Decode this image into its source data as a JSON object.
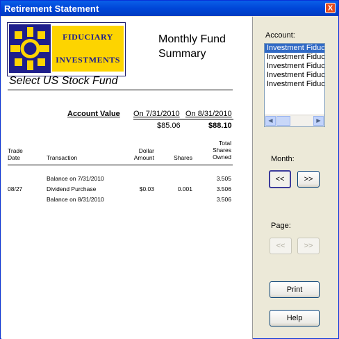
{
  "window": {
    "title": "Retirement Statement",
    "close_glyph": "X"
  },
  "logo": {
    "line1": "FIDUCIARY",
    "line2": "INVESTMENTS"
  },
  "report": {
    "title_line1": "Monthly Fund",
    "title_line2": "Summary",
    "fund_name": "Select US Stock Fund"
  },
  "account_value": {
    "label": "Account Value",
    "date1_label": "On 7/31/2010",
    "date2_label": "On 8/31/2010",
    "value1": "$85.06",
    "value2": "$88.10"
  },
  "table": {
    "headers": {
      "trade_date_1": "Trade",
      "trade_date_2": "Date",
      "transaction": "Transaction",
      "dollar_1": "Dollar",
      "dollar_2": "Amount",
      "shares": "Shares",
      "total_1": "Total",
      "total_2": "Shares",
      "total_3": "Owned"
    },
    "rows": [
      {
        "date": "",
        "transaction": "Balance on 7/31/2010",
        "amount": "",
        "shares": "",
        "total": "3.505"
      },
      {
        "date": "08/27",
        "transaction": "Dividend Purchase",
        "amount": "$0.03",
        "shares": "0.001",
        "total": "3.506"
      },
      {
        "date": "",
        "transaction": "Balance on 8/31/2010",
        "amount": "",
        "shares": "",
        "total": "3.506"
      }
    ]
  },
  "sidebar": {
    "account_label": "Account:",
    "accounts": [
      "Investment Fiduc",
      "Investment Fiduc",
      "Investment Fiduc",
      "Investment Fiduc",
      "Investment Fiduc"
    ],
    "month_label": "Month:",
    "prev_month": "<<",
    "next_month": ">>",
    "page_label": "Page:",
    "prev_page": "<<",
    "next_page": ">>",
    "print": "Print",
    "help": "Help"
  },
  "colors": {
    "titlebar": "#0046D8",
    "selection": "#316AC5",
    "logo_yellow": "#FDD400",
    "logo_navy": "#1E1E8C"
  }
}
